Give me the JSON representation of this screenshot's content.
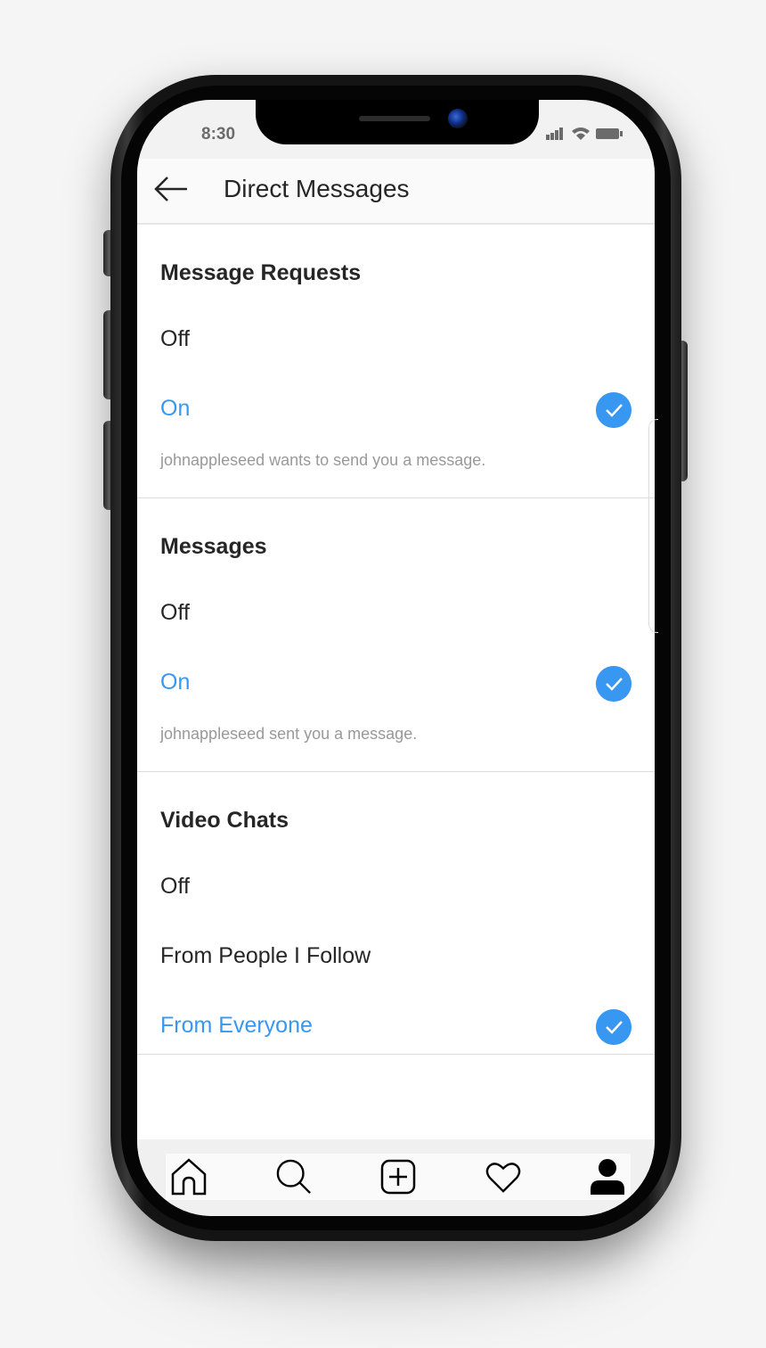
{
  "status_bar": {
    "time": "8:30",
    "icons": [
      "signal-icon",
      "wifi-icon",
      "battery-icon"
    ]
  },
  "header": {
    "back_icon": "arrow-left-icon",
    "title": "Direct Messages"
  },
  "sections": [
    {
      "title": "Message Requests",
      "options": [
        {
          "label": "Off",
          "selected": false
        },
        {
          "label": "On",
          "selected": true
        }
      ],
      "hint": "johnappleseed wants to send you a message."
    },
    {
      "title": "Messages",
      "options": [
        {
          "label": "Off",
          "selected": false
        },
        {
          "label": "On",
          "selected": true
        }
      ],
      "hint": "johnappleseed sent you a message."
    },
    {
      "title": "Video Chats",
      "options": [
        {
          "label": "Off",
          "selected": false
        },
        {
          "label": "From People I Follow",
          "selected": false
        },
        {
          "label": "From Everyone",
          "selected": true
        }
      ]
    }
  ],
  "tab_bar": {
    "items": [
      {
        "name": "home",
        "icon": "home-icon"
      },
      {
        "name": "search",
        "icon": "search-icon"
      },
      {
        "name": "new-post",
        "icon": "plus-square-icon"
      },
      {
        "name": "activity",
        "icon": "heart-icon"
      },
      {
        "name": "profile",
        "icon": "user-icon"
      }
    ]
  },
  "colors": {
    "accent": "#3897f0",
    "text": "#262626",
    "hint": "#999999"
  }
}
